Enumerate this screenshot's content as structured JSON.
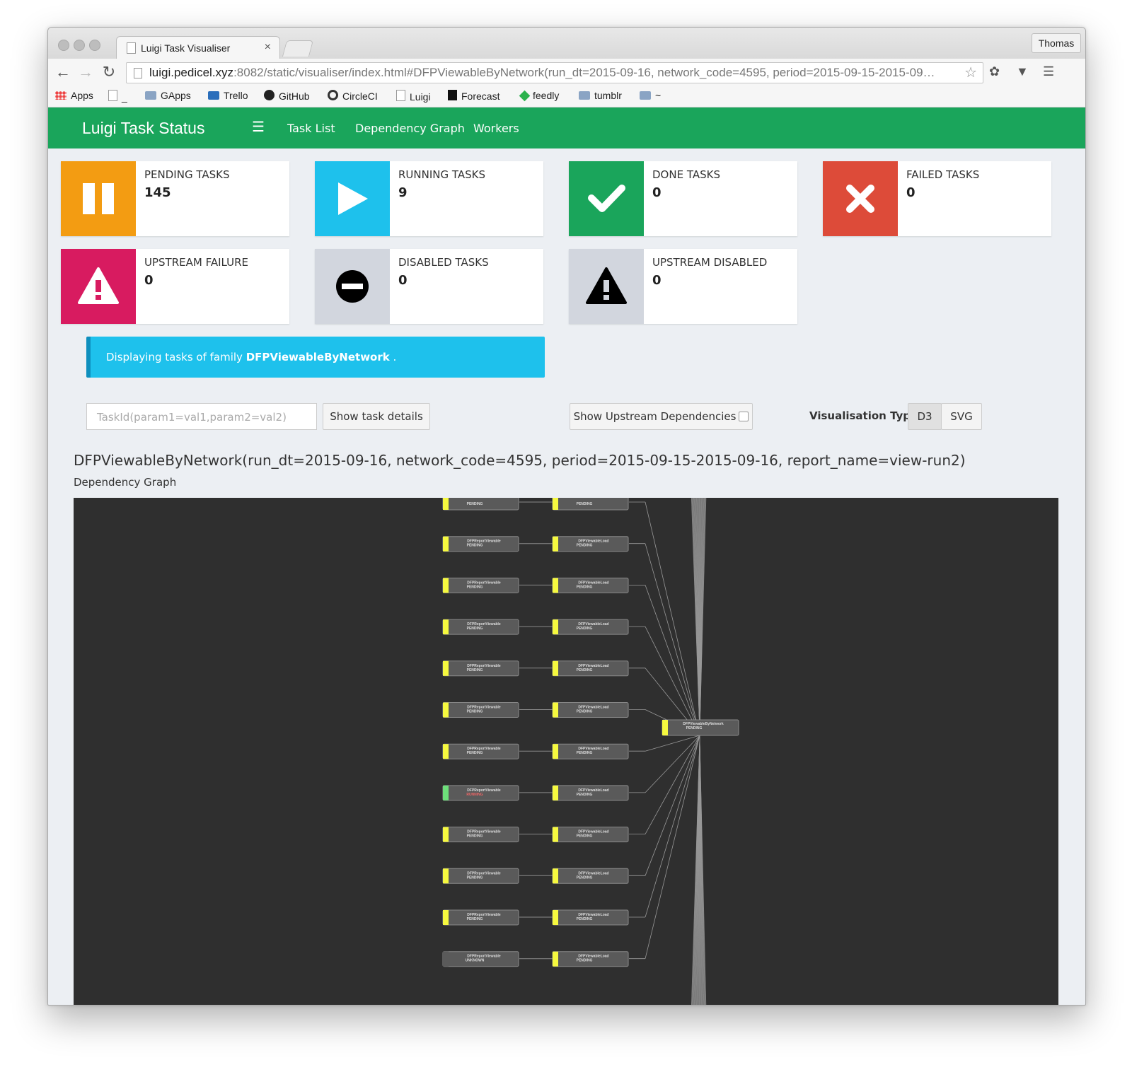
{
  "browser": {
    "tab_title": "Luigi Task Visualiser",
    "tab_close": "×",
    "user": "Thomas",
    "url_host": "luigi.pedicel.xyz",
    "url_rest": ":8082/static/visualiser/index.html#DFPViewableByNetwork(run_dt=2015-09-16, network_code=4595, period=2015-09-15-2015-09…",
    "bookmarks": [
      {
        "label": "Apps",
        "icon": "apps-icon"
      },
      {
        "label": "_",
        "icon": "page-icon"
      },
      {
        "label": "GApps",
        "icon": "folder-icon"
      },
      {
        "label": "Trello",
        "icon": "trello-icon"
      },
      {
        "label": "GitHub",
        "icon": "github-icon"
      },
      {
        "label": "CircleCI",
        "icon": "circleci-icon"
      },
      {
        "label": "Luigi",
        "icon": "page-icon"
      },
      {
        "label": "Forecast",
        "icon": "forecast-icon"
      },
      {
        "label": "feedly",
        "icon": "feedly-icon"
      },
      {
        "label": "tumblr",
        "icon": "folder-icon"
      },
      {
        "label": "~",
        "icon": "folder-icon"
      }
    ]
  },
  "nav": {
    "brand": "Luigi Task Status",
    "links": [
      "Task List",
      "Dependency Graph",
      "Workers"
    ]
  },
  "status_boxes": [
    {
      "label": "PENDING TASKS",
      "count": "145",
      "color": "#f39c12",
      "icon": "pause-icon"
    },
    {
      "label": "RUNNING TASKS",
      "count": "9",
      "color": "#1ec1ec",
      "icon": "play-icon"
    },
    {
      "label": "DONE TASKS",
      "count": "0",
      "color": "#1aa55b",
      "icon": "check-icon"
    },
    {
      "label": "FAILED TASKS",
      "count": "0",
      "color": "#dd4b39",
      "icon": "x-icon"
    },
    {
      "label": "UPSTREAM FAILURE",
      "count": "0",
      "color": "#d81b60",
      "icon": "warning-icon"
    },
    {
      "label": "DISABLED TASKS",
      "count": "0",
      "color": "#d2d6de",
      "icon": "minus-circle-icon"
    },
    {
      "label": "UPSTREAM DISABLED",
      "count": "0",
      "color": "#d2d6de",
      "icon": "warning-icon"
    }
  ],
  "callout": {
    "prefix": "Displaying tasks of family ",
    "family": "DFPViewableByNetwork",
    "suffix": " ."
  },
  "controls": {
    "task_input_placeholder": "TaskId(param1=val1,param2=val2)",
    "show_details": "Show task details",
    "show_upstream": "Show Upstream Dependencies",
    "vis_label": "Visualisation Type",
    "vis_options": [
      "D3",
      "SVG"
    ],
    "vis_selected": "D3"
  },
  "task_heading": "DFPViewableByNetwork(run_dt=2015-09-16, network_code=4595, period=2015-09-15-2015-09-16, report_name=view-run2)",
  "graph_heading": "Dependency Graph",
  "graph": {
    "root": {
      "name": "DFPViewableByNetwork",
      "status": "PENDING"
    },
    "rows": [
      {
        "left": {
          "name": "",
          "status": "PENDING"
        },
        "right": {
          "name": "",
          "status": "PENDING"
        }
      },
      {
        "left": {
          "name": "DFPReportViewable",
          "status": "PENDING"
        },
        "right": {
          "name": "DFPViewableLoad",
          "status": "PENDING"
        }
      },
      {
        "left": {
          "name": "DFPReportViewable",
          "status": "PENDING"
        },
        "right": {
          "name": "DFPViewableLoad",
          "status": "PENDING"
        }
      },
      {
        "left": {
          "name": "DFPReportViewable",
          "status": "PENDING"
        },
        "right": {
          "name": "DFPViewableLoad",
          "status": "PENDING"
        }
      },
      {
        "left": {
          "name": "DFPReportViewable",
          "status": "PENDING"
        },
        "right": {
          "name": "DFPViewableLoad",
          "status": "PENDING"
        }
      },
      {
        "left": {
          "name": "DFPReportViewable",
          "status": "PENDING"
        },
        "right": {
          "name": "DFPViewableLoad",
          "status": "PENDING"
        }
      },
      {
        "left": {
          "name": "DFPReportViewable",
          "status": "PENDING"
        },
        "right": {
          "name": "DFPViewableLoad",
          "status": "PENDING"
        }
      },
      {
        "left": {
          "name": "DFPReportViewable",
          "status": "RUNNING"
        },
        "right": {
          "name": "DFPViewableLoad",
          "status": "PENDING"
        }
      },
      {
        "left": {
          "name": "DFPReportViewable",
          "status": "PENDING"
        },
        "right": {
          "name": "DFPViewableLoad",
          "status": "PENDING"
        }
      },
      {
        "left": {
          "name": "DFPReportViewable",
          "status": "PENDING"
        },
        "right": {
          "name": "DFPViewableLoad",
          "status": "PENDING"
        }
      },
      {
        "left": {
          "name": "DFPReportViewable",
          "status": "PENDING"
        },
        "right": {
          "name": "DFPViewableLoad",
          "status": "PENDING"
        }
      },
      {
        "left": {
          "name": "DFPReportViewable",
          "status": "UNKNOWN"
        },
        "right": {
          "name": "DFPViewableLoad",
          "status": "PENDING"
        }
      }
    ],
    "status_colors": {
      "PENDING": "#f6f93f",
      "RUNNING": "#6ddf7a",
      "UNKNOWN": "#5a5a5a"
    }
  }
}
